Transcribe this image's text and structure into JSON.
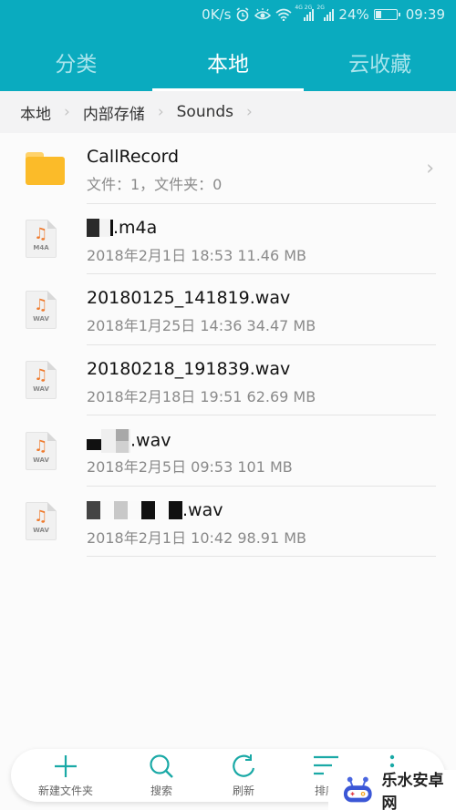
{
  "status_bar": {
    "net_speed": "0K/s",
    "signal1_label": "4G 2G",
    "signal2_label": "2G",
    "battery_percent": "24%",
    "battery_level": 0.24,
    "time": "09:39"
  },
  "tabs": [
    {
      "label": "分类",
      "active": false
    },
    {
      "label": "本地",
      "active": true
    },
    {
      "label": "云收藏",
      "active": false
    }
  ],
  "breadcrumb": [
    "本地",
    "内部存储",
    "Sounds"
  ],
  "folders": [
    {
      "name": "CallRecord",
      "meta": "文件：1，文件夹：0"
    }
  ],
  "files": [
    {
      "name_suffix": ".m4a",
      "ext_label": "M4A",
      "meta": "2018年2月1日 18:53 11.46 MB",
      "redacted": true
    },
    {
      "name": "20180125_141819.wav",
      "ext_label": "WAV",
      "meta": "2018年1月25日 14:36 34.47 MB",
      "redacted": false
    },
    {
      "name": "20180218_191839.wav",
      "ext_label": "WAV",
      "meta": "2018年2月18日 19:51 62.69 MB",
      "redacted": false
    },
    {
      "name_suffix": ".wav",
      "ext_label": "WAV",
      "meta": "2018年2月5日 09:53 101 MB",
      "redacted": true
    },
    {
      "name_suffix": ".wav",
      "ext_label": "WAV",
      "meta": "2018年2月1日 10:42 98.91 MB",
      "redacted": true
    }
  ],
  "bottom_bar": [
    {
      "label": "新建文件夹",
      "icon": "plus-icon"
    },
    {
      "label": "搜索",
      "icon": "search-icon"
    },
    {
      "label": "刷新",
      "icon": "refresh-icon"
    },
    {
      "label": "排序",
      "icon": "sort-icon"
    },
    {
      "label": "",
      "icon": "more-icon"
    }
  ],
  "watermark": {
    "text": "乐水安卓网"
  },
  "colors": {
    "accent": "#0aabbf",
    "folder": "#fbbb29",
    "music_note": "#ef7b2e",
    "icon_teal": "#1aa9a6"
  }
}
